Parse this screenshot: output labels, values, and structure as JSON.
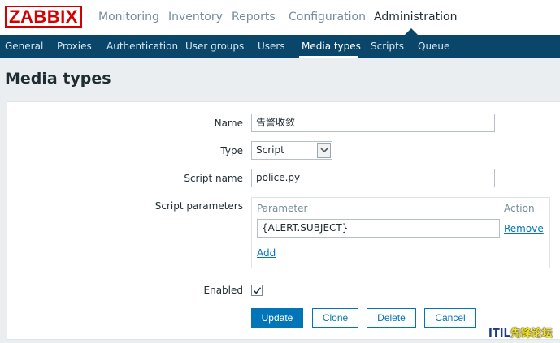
{
  "brand": {
    "logo_text": "ZABBIX"
  },
  "top_nav": {
    "items": [
      "Monitoring",
      "Inventory",
      "Reports",
      "Configuration",
      "Administration"
    ]
  },
  "sub_nav": {
    "items": [
      "General",
      "Proxies",
      "Authentication",
      "User groups",
      "Users",
      "Media types",
      "Scripts",
      "Queue"
    ]
  },
  "page": {
    "title": "Media types"
  },
  "form": {
    "name_label": "Name",
    "name_value": "告警收敛",
    "type_label": "Type",
    "type_value": "Script",
    "script_name_label": "Script name",
    "script_name_value": "police.py",
    "script_params_label": "Script parameters",
    "params_header_parameter": "Parameter",
    "params_header_action": "Action",
    "param_1_value": "{ALERT.SUBJECT}",
    "param_remove_label": "Remove",
    "param_add_label": "Add",
    "enabled_label": "Enabled",
    "enabled_checked": true
  },
  "buttons": {
    "update": "Update",
    "clone": "Clone",
    "delete": "Delete",
    "cancel": "Cancel"
  },
  "watermark": {
    "prefix": "ITIL",
    "suffix": "先锋论坛"
  },
  "colors": {
    "accent": "#0275b8",
    "header_bg": "#0a466a",
    "logo_red": "#d40000"
  }
}
